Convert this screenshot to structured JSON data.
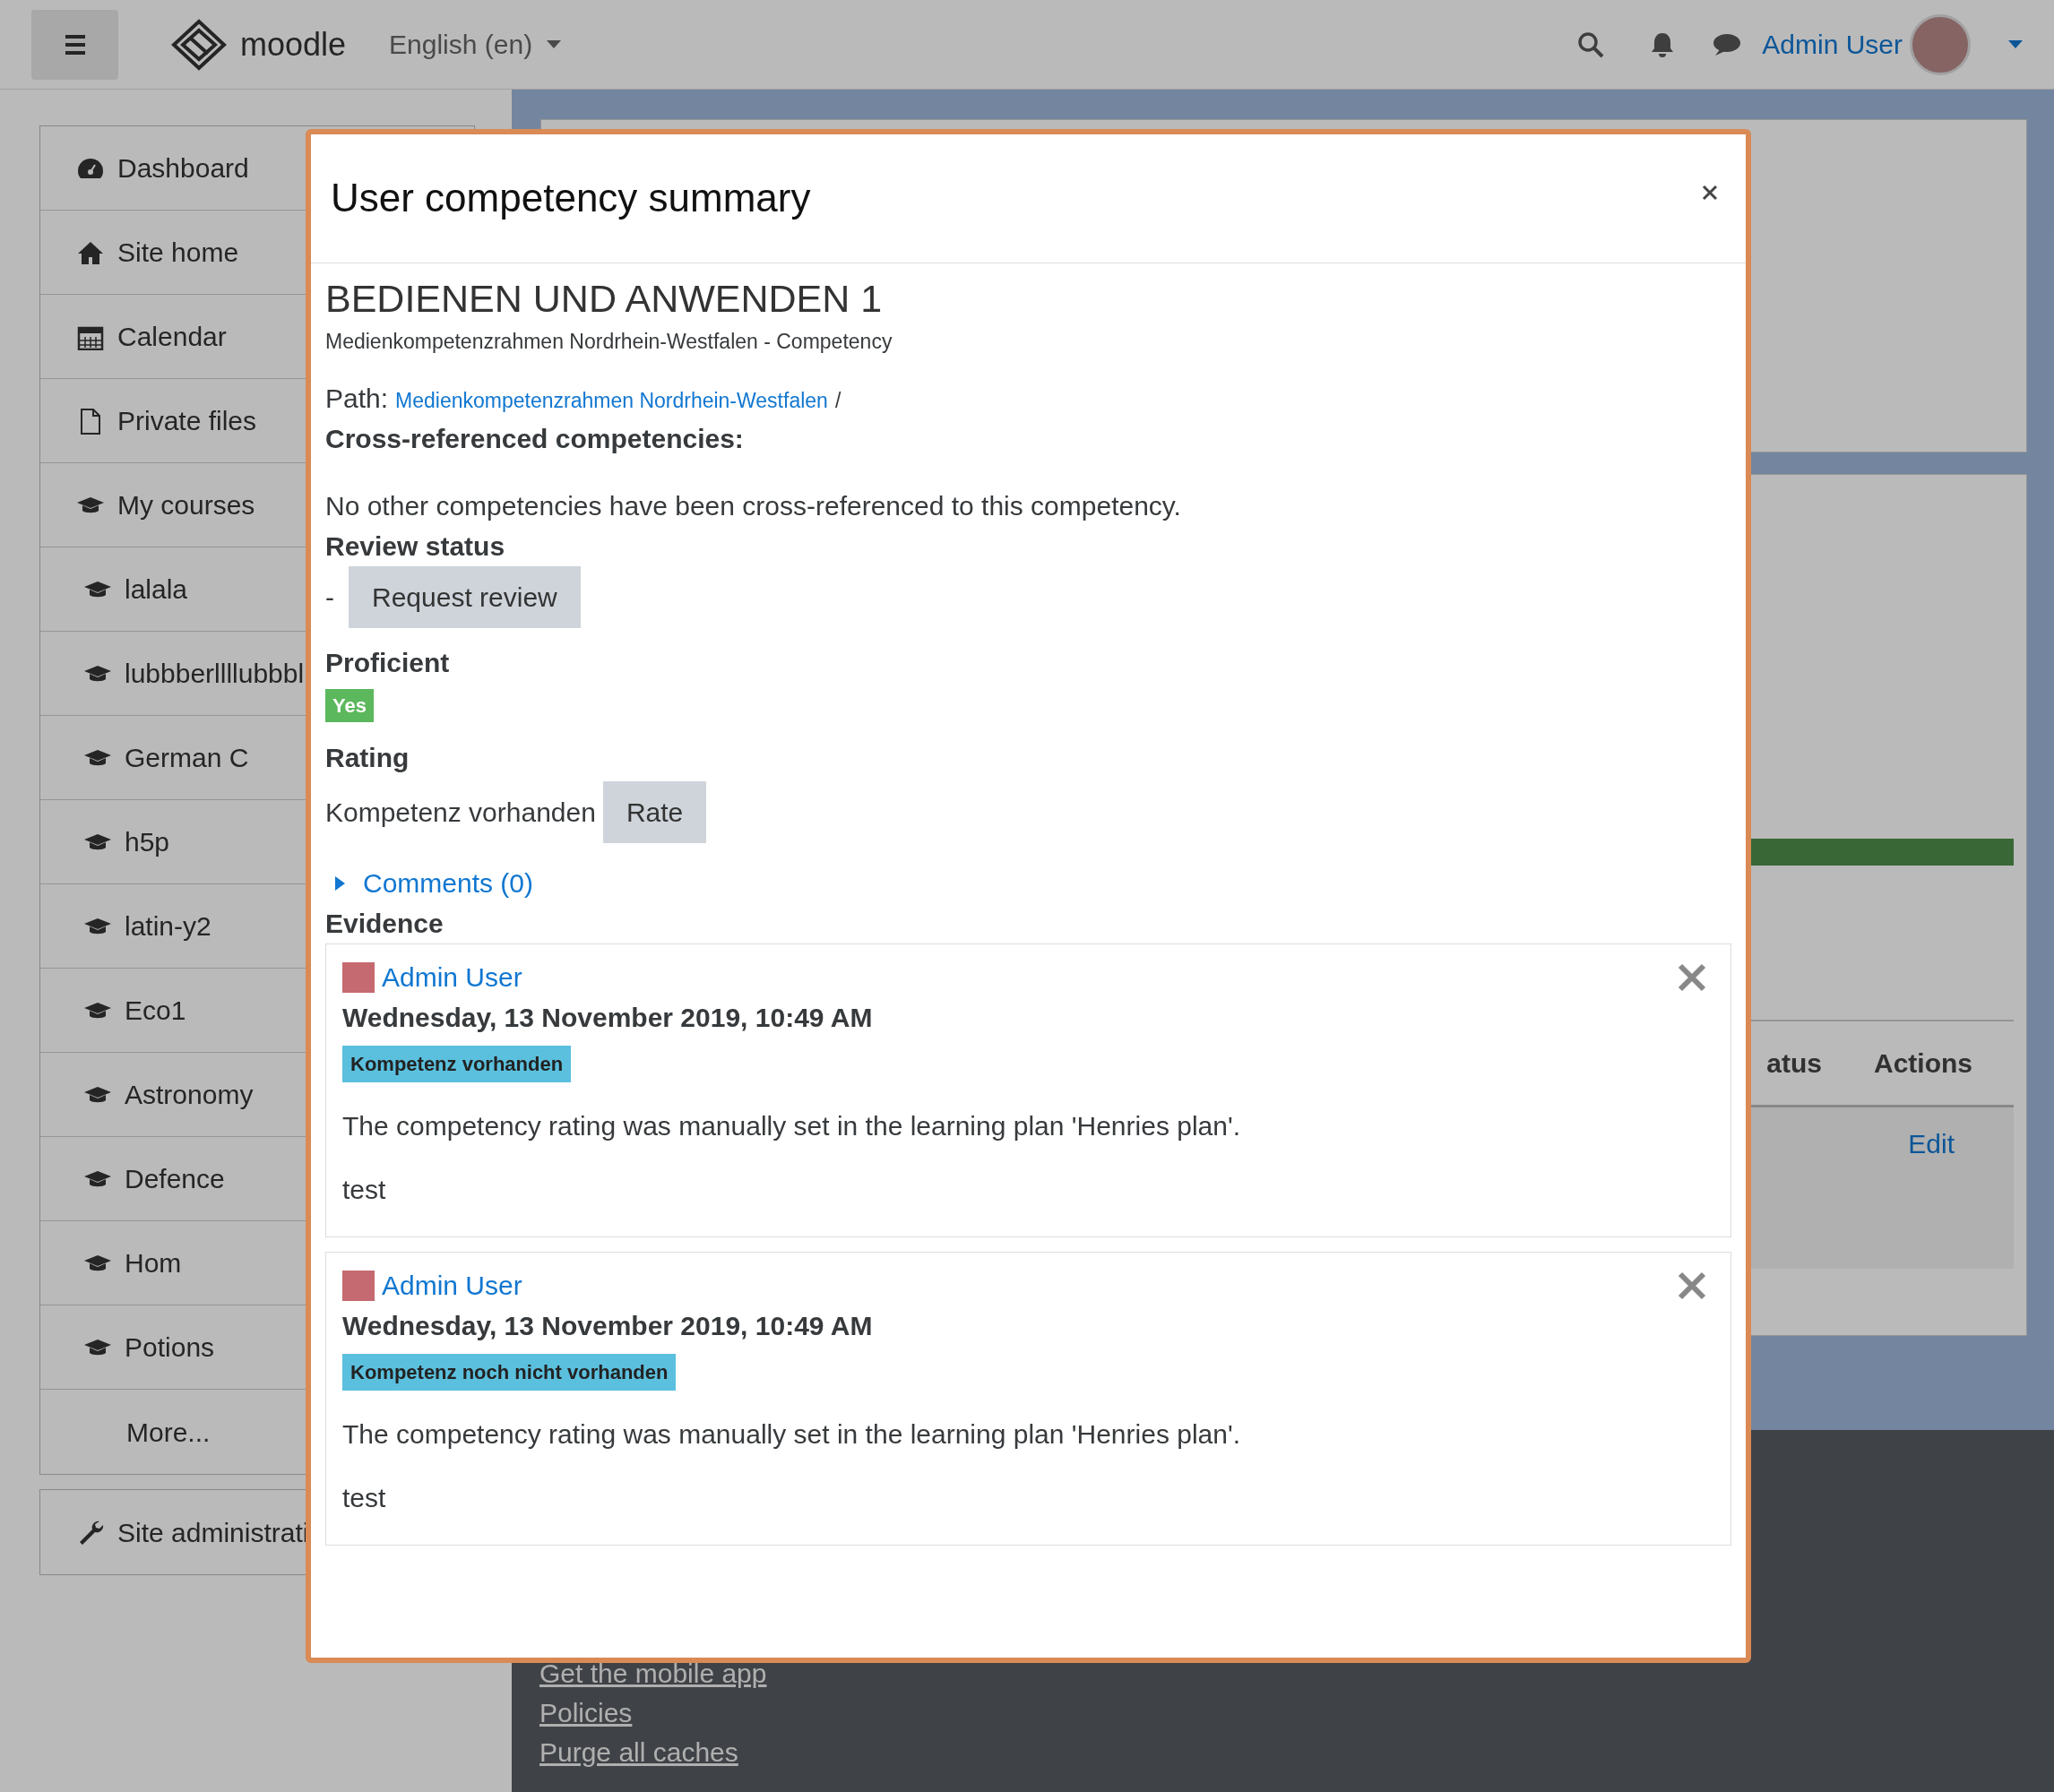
{
  "navbar": {
    "brand": "moodle",
    "language": "English (en)",
    "user_name": "Admin User"
  },
  "sidebar": {
    "items": [
      {
        "label": "Dashboard",
        "kind": "dashboard"
      },
      {
        "label": "Site home",
        "kind": "home"
      },
      {
        "label": "Calendar",
        "kind": "calendar"
      },
      {
        "label": "Private files",
        "kind": "file"
      },
      {
        "label": "My courses",
        "kind": "courses"
      },
      {
        "label": "lalala",
        "kind": "course"
      },
      {
        "label": "lubbberllllubbbl",
        "kind": "course"
      },
      {
        "label": "German C",
        "kind": "course"
      },
      {
        "label": "h5p",
        "kind": "course"
      },
      {
        "label": "latin-y2",
        "kind": "course"
      },
      {
        "label": "Eco1",
        "kind": "course"
      },
      {
        "label": "Astronomy",
        "kind": "course"
      },
      {
        "label": "Defence",
        "kind": "course"
      },
      {
        "label": "Hom",
        "kind": "course"
      },
      {
        "label": "Potions",
        "kind": "course"
      },
      {
        "label": "More...",
        "kind": "more"
      }
    ],
    "admin_item": {
      "label": "Site administrati"
    }
  },
  "background": {
    "table_headers": [
      "atus",
      "Actions"
    ],
    "row_action": "Edit"
  },
  "footer": {
    "links": [
      "Get the mobile app",
      "Policies",
      "Purge all caches"
    ]
  },
  "modal": {
    "title": "User competency summary",
    "competency_name": "BEDIENEN UND ANWENDEN 1",
    "framework_line": "Medienkompetenzrahmen Nordrhein-Westfalen - Competency",
    "path_label": "Path:",
    "path_link": "Medienkompetenzrahmen Nordrhein-Westfalen",
    "path_separator": "/",
    "crossref_heading": "Cross-referenced competencies:",
    "crossref_text": "No other competencies have been cross-referenced to this competency.",
    "review_heading": "Review status",
    "review_value": "-",
    "review_button": "Request review",
    "proficient_heading": "Proficient",
    "proficient_badge": "Yes",
    "rating_heading": "Rating",
    "rating_value": "Kompetenz vorhanden",
    "rate_button": "Rate",
    "comments_link": "Comments (0)",
    "comments_expanded": false,
    "evidence_heading": "Evidence",
    "evidence": [
      {
        "author": "Admin User",
        "date": "Wednesday, 13 November 2019, 10:49 AM",
        "badge": "Kompetenz vorhanden",
        "description": "The competency rating was manually set in the learning plan 'Henries plan'.",
        "note": "test"
      },
      {
        "author": "Admin User",
        "date": "Wednesday, 13 November 2019, 10:49 AM",
        "badge": "Kompetenz noch nicht vorhanden",
        "description": "The competency rating was manually set in the learning plan 'Henries plan'.",
        "note": "test"
      }
    ]
  }
}
